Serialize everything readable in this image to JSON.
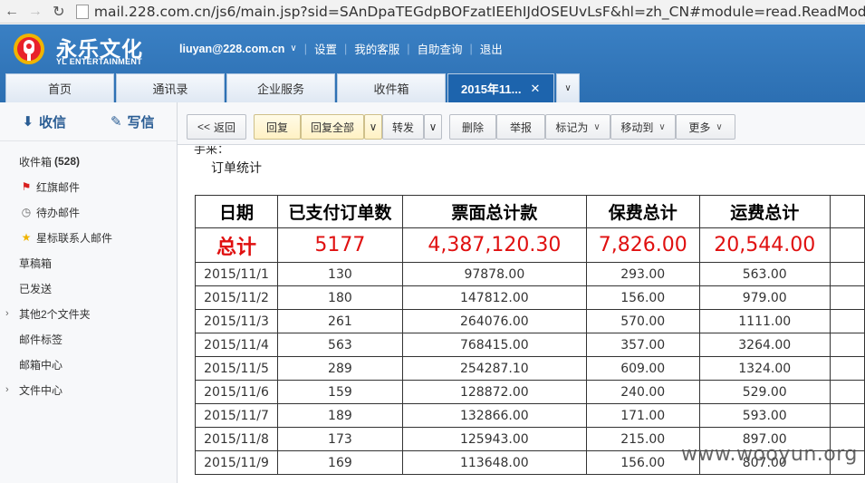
{
  "browser": {
    "url": "mail.228.com.cn/js6/main.jsp?sid=SAnDpaTEGdpBOFzatIEEhIJdOSEUvLsF&hl=zh_CN#module=read.ReadMod"
  },
  "header": {
    "logo_cn": "永乐文化",
    "logo_en": "YL ENTERTAINMENT",
    "account": "liuyan@228.com.cn",
    "menu": [
      "设置",
      "我的客服",
      "自助查询",
      "退出"
    ],
    "tabs": [
      "首页",
      "通讯录",
      "企业服务",
      "收件箱"
    ],
    "active_tab": "2015年11...",
    "colors": {
      "header_bg": "#2c6fb2",
      "active_tab": "#1d64ad"
    }
  },
  "sidebar": {
    "receive": "收信",
    "write": "写信",
    "inbox_label": "收件箱",
    "inbox_count": "(528)",
    "items": [
      {
        "label": "红旗邮件",
        "icon": "red-flag-icon"
      },
      {
        "label": "待办邮件",
        "icon": "clock-icon"
      },
      {
        "label": "星标联系人邮件",
        "icon": "star-icon"
      },
      {
        "label": "草稿箱"
      },
      {
        "label": "已发送"
      },
      {
        "label": "其他2个文件夹",
        "expandable": true
      },
      {
        "label": "邮件标签"
      },
      {
        "label": "邮箱中心"
      },
      {
        "label": "文件中心",
        "expandable": true
      }
    ]
  },
  "toolbar": {
    "back": "返回",
    "reply": "回复",
    "reply_all": "回复全部",
    "forward": "转发",
    "delete": "删除",
    "report": "举报",
    "mark_as": "标记为",
    "move_to": "移动到",
    "more": "更多"
  },
  "mail": {
    "prev_text": "手来：",
    "subject": "订单统计",
    "table": {
      "headers": [
        "日期",
        "已支付订单数",
        "票面总计款",
        "保费总计",
        "运费总计"
      ],
      "total": [
        "总计",
        "5177",
        "4,387,120.30",
        "7,826.00",
        "20,544.00"
      ],
      "rows": [
        [
          "2015/11/1",
          "130",
          "97878.00",
          "293.00",
          "563.00"
        ],
        [
          "2015/11/2",
          "180",
          "147812.00",
          "156.00",
          "979.00"
        ],
        [
          "2015/11/3",
          "261",
          "264076.00",
          "570.00",
          "1111.00"
        ],
        [
          "2015/11/4",
          "563",
          "768415.00",
          "357.00",
          "3264.00"
        ],
        [
          "2015/11/5",
          "289",
          "254287.10",
          "609.00",
          "1324.00"
        ],
        [
          "2015/11/6",
          "159",
          "128872.00",
          "240.00",
          "529.00"
        ],
        [
          "2015/11/7",
          "189",
          "132866.00",
          "171.00",
          "593.00"
        ],
        [
          "2015/11/8",
          "173",
          "125943.00",
          "215.00",
          "897.00"
        ],
        [
          "2015/11/9",
          "169",
          "113648.00",
          "156.00",
          "807.00"
        ]
      ]
    }
  },
  "watermark": "www.wooyun.org"
}
